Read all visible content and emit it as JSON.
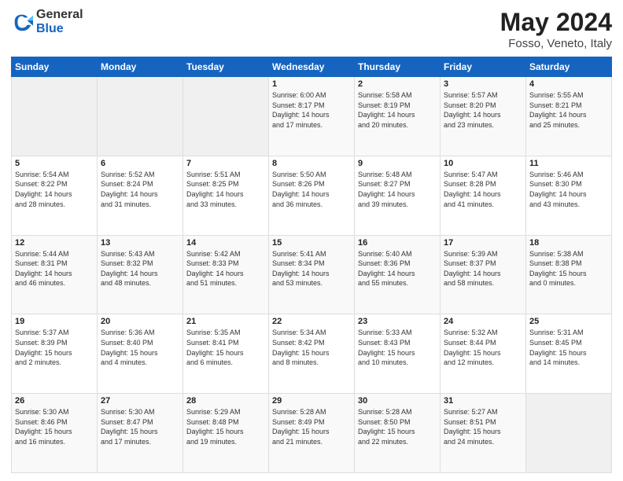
{
  "logo": {
    "general": "General",
    "blue": "Blue"
  },
  "header": {
    "month": "May 2024",
    "location": "Fosso, Veneto, Italy"
  },
  "weekdays": [
    "Sunday",
    "Monday",
    "Tuesday",
    "Wednesday",
    "Thursday",
    "Friday",
    "Saturday"
  ],
  "weeks": [
    [
      {
        "day": "",
        "info": ""
      },
      {
        "day": "",
        "info": ""
      },
      {
        "day": "",
        "info": ""
      },
      {
        "day": "1",
        "info": "Sunrise: 6:00 AM\nSunset: 8:17 PM\nDaylight: 14 hours\nand 17 minutes."
      },
      {
        "day": "2",
        "info": "Sunrise: 5:58 AM\nSunset: 8:19 PM\nDaylight: 14 hours\nand 20 minutes."
      },
      {
        "day": "3",
        "info": "Sunrise: 5:57 AM\nSunset: 8:20 PM\nDaylight: 14 hours\nand 23 minutes."
      },
      {
        "day": "4",
        "info": "Sunrise: 5:55 AM\nSunset: 8:21 PM\nDaylight: 14 hours\nand 25 minutes."
      }
    ],
    [
      {
        "day": "5",
        "info": "Sunrise: 5:54 AM\nSunset: 8:22 PM\nDaylight: 14 hours\nand 28 minutes."
      },
      {
        "day": "6",
        "info": "Sunrise: 5:52 AM\nSunset: 8:24 PM\nDaylight: 14 hours\nand 31 minutes."
      },
      {
        "day": "7",
        "info": "Sunrise: 5:51 AM\nSunset: 8:25 PM\nDaylight: 14 hours\nand 33 minutes."
      },
      {
        "day": "8",
        "info": "Sunrise: 5:50 AM\nSunset: 8:26 PM\nDaylight: 14 hours\nand 36 minutes."
      },
      {
        "day": "9",
        "info": "Sunrise: 5:48 AM\nSunset: 8:27 PM\nDaylight: 14 hours\nand 39 minutes."
      },
      {
        "day": "10",
        "info": "Sunrise: 5:47 AM\nSunset: 8:28 PM\nDaylight: 14 hours\nand 41 minutes."
      },
      {
        "day": "11",
        "info": "Sunrise: 5:46 AM\nSunset: 8:30 PM\nDaylight: 14 hours\nand 43 minutes."
      }
    ],
    [
      {
        "day": "12",
        "info": "Sunrise: 5:44 AM\nSunset: 8:31 PM\nDaylight: 14 hours\nand 46 minutes."
      },
      {
        "day": "13",
        "info": "Sunrise: 5:43 AM\nSunset: 8:32 PM\nDaylight: 14 hours\nand 48 minutes."
      },
      {
        "day": "14",
        "info": "Sunrise: 5:42 AM\nSunset: 8:33 PM\nDaylight: 14 hours\nand 51 minutes."
      },
      {
        "day": "15",
        "info": "Sunrise: 5:41 AM\nSunset: 8:34 PM\nDaylight: 14 hours\nand 53 minutes."
      },
      {
        "day": "16",
        "info": "Sunrise: 5:40 AM\nSunset: 8:36 PM\nDaylight: 14 hours\nand 55 minutes."
      },
      {
        "day": "17",
        "info": "Sunrise: 5:39 AM\nSunset: 8:37 PM\nDaylight: 14 hours\nand 58 minutes."
      },
      {
        "day": "18",
        "info": "Sunrise: 5:38 AM\nSunset: 8:38 PM\nDaylight: 15 hours\nand 0 minutes."
      }
    ],
    [
      {
        "day": "19",
        "info": "Sunrise: 5:37 AM\nSunset: 8:39 PM\nDaylight: 15 hours\nand 2 minutes."
      },
      {
        "day": "20",
        "info": "Sunrise: 5:36 AM\nSunset: 8:40 PM\nDaylight: 15 hours\nand 4 minutes."
      },
      {
        "day": "21",
        "info": "Sunrise: 5:35 AM\nSunset: 8:41 PM\nDaylight: 15 hours\nand 6 minutes."
      },
      {
        "day": "22",
        "info": "Sunrise: 5:34 AM\nSunset: 8:42 PM\nDaylight: 15 hours\nand 8 minutes."
      },
      {
        "day": "23",
        "info": "Sunrise: 5:33 AM\nSunset: 8:43 PM\nDaylight: 15 hours\nand 10 minutes."
      },
      {
        "day": "24",
        "info": "Sunrise: 5:32 AM\nSunset: 8:44 PM\nDaylight: 15 hours\nand 12 minutes."
      },
      {
        "day": "25",
        "info": "Sunrise: 5:31 AM\nSunset: 8:45 PM\nDaylight: 15 hours\nand 14 minutes."
      }
    ],
    [
      {
        "day": "26",
        "info": "Sunrise: 5:30 AM\nSunset: 8:46 PM\nDaylight: 15 hours\nand 16 minutes."
      },
      {
        "day": "27",
        "info": "Sunrise: 5:30 AM\nSunset: 8:47 PM\nDaylight: 15 hours\nand 17 minutes."
      },
      {
        "day": "28",
        "info": "Sunrise: 5:29 AM\nSunset: 8:48 PM\nDaylight: 15 hours\nand 19 minutes."
      },
      {
        "day": "29",
        "info": "Sunrise: 5:28 AM\nSunset: 8:49 PM\nDaylight: 15 hours\nand 21 minutes."
      },
      {
        "day": "30",
        "info": "Sunrise: 5:28 AM\nSunset: 8:50 PM\nDaylight: 15 hours\nand 22 minutes."
      },
      {
        "day": "31",
        "info": "Sunrise: 5:27 AM\nSunset: 8:51 PM\nDaylight: 15 hours\nand 24 minutes."
      },
      {
        "day": "",
        "info": ""
      }
    ]
  ]
}
